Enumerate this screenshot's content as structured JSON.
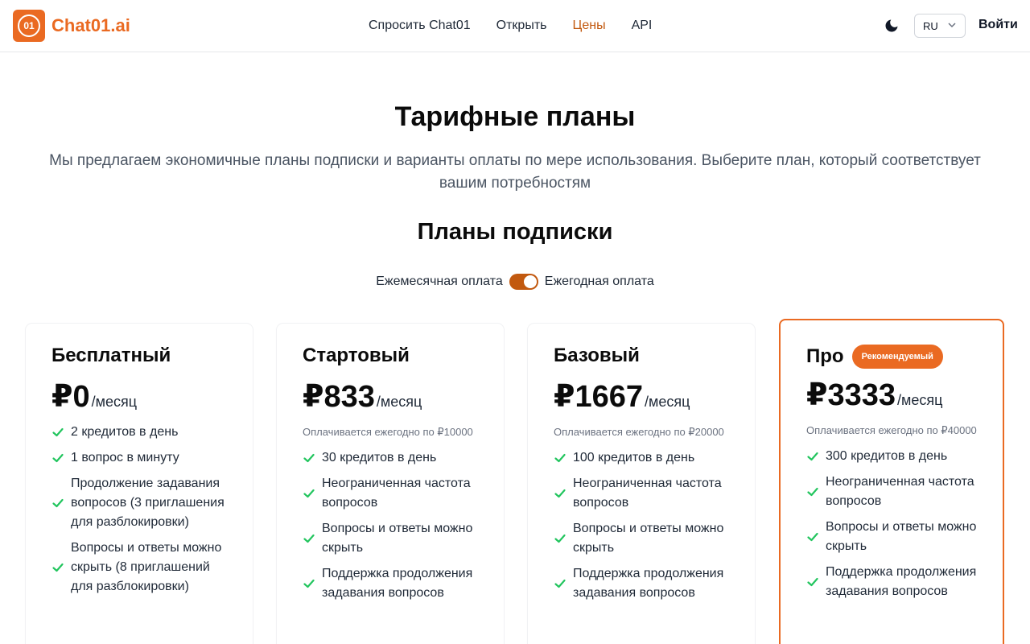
{
  "header": {
    "logo_mark": "01",
    "brand": "Chat01.ai",
    "nav": [
      {
        "label": "Спросить Chat01",
        "active": false
      },
      {
        "label": "Открыть",
        "active": false
      },
      {
        "label": "Цены",
        "active": true
      },
      {
        "label": "API",
        "active": false
      }
    ],
    "theme_icon": "moon-icon",
    "language": "RU",
    "login_label": "Войти"
  },
  "page": {
    "title": "Тарифные планы",
    "subtitle": "Мы предлагаем экономичные планы подписки и варианты оплаты по мере использования. Выберите план, который соответствует вашим потребностям",
    "section_title": "Планы подписки"
  },
  "billing": {
    "monthly_label": "Ежемесячная оплата",
    "yearly_label": "Ежегодная оплата",
    "yearly_selected": true
  },
  "colors": {
    "brand": "#ea6a22",
    "accent_dark": "#c2590f",
    "check": "#22c55e"
  },
  "plans": [
    {
      "name": "Бесплатный",
      "badge": "",
      "price": "₽0",
      "period": "/месяц",
      "billed_note": "",
      "features": [
        "2 кредитов в день",
        "1 вопрос в минуту",
        "Продолжение задавания вопросов (3 приглашения для разблокировки)",
        "Вопросы и ответы можно скрыть (8 приглашений для разблокировки)"
      ]
    },
    {
      "name": "Стартовый",
      "badge": "",
      "price": "₽833",
      "period": "/месяц",
      "billed_note": "Оплачивается ежегодно по ₽10000",
      "features": [
        "30 кредитов в день",
        "Неограниченная частота вопросов",
        "Вопросы и ответы можно скрыть",
        "Поддержка продолжения задавания вопросов"
      ]
    },
    {
      "name": "Базовый",
      "badge": "",
      "price": "₽1667",
      "period": "/месяц",
      "billed_note": "Оплачивается ежегодно по ₽20000",
      "features": [
        "100 кредитов в день",
        "Неограниченная частота вопросов",
        "Вопросы и ответы можно скрыть",
        "Поддержка продолжения задавания вопросов"
      ]
    },
    {
      "name": "Про",
      "badge": "Рекомендуемый",
      "price": "₽3333",
      "period": "/месяц",
      "billed_note": "Оплачивается ежегодно по ₽40000",
      "features": [
        "300 кредитов в день",
        "Неограниченная частота вопросов",
        "Вопросы и ответы можно скрыть",
        "Поддержка продолжения задавания вопросов"
      ]
    }
  ]
}
